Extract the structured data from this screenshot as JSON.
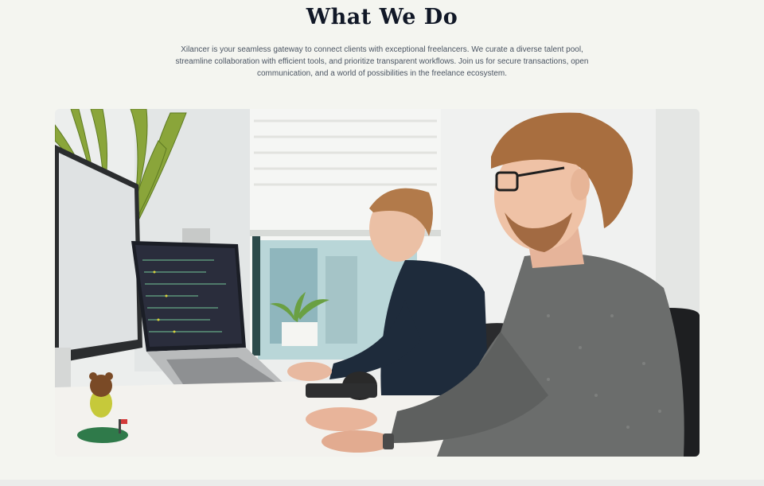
{
  "section": {
    "title": "What We Do",
    "description": "Xilancer is your seamless gateway to connect clients with exceptional freelancers. We curate a diverse talent pool, streamline collaboration with efficient tools, and prioritize transparent workflows. Join us for secure transactions, open communication, and a world of possibilities in the freelance ecosystem."
  },
  "image": {
    "subject": "two-men-working-at-desks-with-laptops-in-bright-office"
  },
  "colors": {
    "background": "#f4f5f0",
    "title": "#111827",
    "text": "#4b5563"
  }
}
